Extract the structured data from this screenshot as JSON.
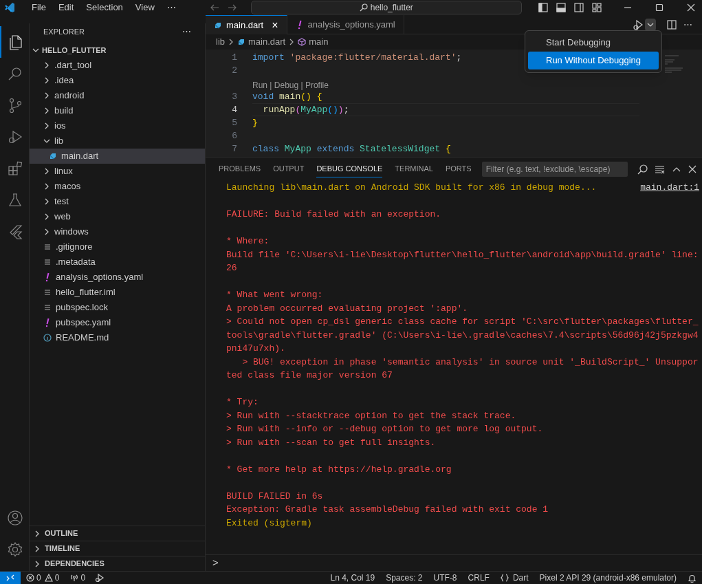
{
  "title_bar": {
    "menus": [
      "File",
      "Edit",
      "Selection",
      "View",
      "⋯"
    ],
    "search": "hello_flutter"
  },
  "activity_bar": {
    "top": [
      {
        "kind": "explorer",
        "selected": true
      },
      {
        "kind": "search",
        "selected": false
      },
      {
        "kind": "source-control",
        "selected": false
      },
      {
        "kind": "run-debug",
        "selected": false
      },
      {
        "kind": "extensions",
        "selected": false
      },
      {
        "kind": "testing",
        "selected": false
      },
      {
        "kind": "flutter",
        "selected": false
      }
    ],
    "bottom": [
      {
        "kind": "account"
      },
      {
        "kind": "settings"
      }
    ]
  },
  "sidebar": {
    "title": "EXPLORER",
    "more": "⋯",
    "root": "HELLO_FLUTTER",
    "items": [
      {
        "label": ".dart_tool",
        "kind": "folder",
        "expanded": false,
        "selected": false
      },
      {
        "label": ".idea",
        "kind": "folder",
        "expanded": false,
        "selected": false
      },
      {
        "label": "android",
        "kind": "folder",
        "expanded": false,
        "selected": false
      },
      {
        "label": "build",
        "kind": "folder",
        "expanded": false,
        "selected": false
      },
      {
        "label": "ios",
        "kind": "folder",
        "expanded": false,
        "selected": false
      },
      {
        "label": "lib",
        "kind": "folder",
        "expanded": true,
        "selected": false,
        "children": [
          {
            "label": "main.dart",
            "kind": "dart",
            "selected": true
          }
        ]
      },
      {
        "label": "linux",
        "kind": "folder",
        "expanded": false,
        "selected": false
      },
      {
        "label": "macos",
        "kind": "folder",
        "expanded": false,
        "selected": false
      },
      {
        "label": "test",
        "kind": "folder",
        "expanded": false,
        "selected": false
      },
      {
        "label": "web",
        "kind": "folder",
        "expanded": false,
        "selected": false
      },
      {
        "label": "windows",
        "kind": "folder",
        "expanded": false,
        "selected": false
      },
      {
        "label": ".gitignore",
        "kind": "text",
        "selected": false
      },
      {
        "label": ".metadata",
        "kind": "text",
        "selected": false
      },
      {
        "label": "analysis_options.yaml",
        "kind": "yaml",
        "selected": false
      },
      {
        "label": "hello_flutter.iml",
        "kind": "text",
        "selected": false
      },
      {
        "label": "pubspec.lock",
        "kind": "text",
        "selected": false
      },
      {
        "label": "pubspec.yaml",
        "kind": "yaml",
        "selected": false
      },
      {
        "label": "README.md",
        "kind": "info",
        "selected": false
      }
    ],
    "sections": [
      "OUTLINE",
      "TIMELINE",
      "DEPENDENCIES"
    ]
  },
  "editor": {
    "tabs": [
      {
        "label": "main.dart",
        "kind": "dart",
        "selected": true,
        "close": "×"
      },
      {
        "label": "analysis_options.yaml",
        "kind": "yaml",
        "selected": false
      }
    ],
    "breadcrumb": [
      "lib",
      "main.dart",
      "main"
    ],
    "lines": [
      {
        "number": "1",
        "current": false,
        "tokens": [
          {
            "t": "import ",
            "kind": "keyword"
          },
          {
            "t": "'package:flutter/material.dart'",
            "kind": "string"
          },
          {
            "t": ";",
            "kind": "plain"
          }
        ]
      },
      {
        "number": "2",
        "current": false
      },
      {
        "number": "3",
        "current": false,
        "lens": "Run | Debug | Profile",
        "tokens": [
          {
            "t": "void ",
            "kind": "keyword"
          },
          {
            "t": "main",
            "kind": "function"
          },
          {
            "t": "() {",
            "kind": "bracket"
          }
        ]
      },
      {
        "number": "4",
        "current": true,
        "tokens": [
          {
            "t": "  runApp",
            "kind": "function"
          },
          {
            "t": "(",
            "kind": "bracket2"
          },
          {
            "t": "MyApp",
            "kind": "class"
          },
          {
            "t": "()",
            "kind": "bracket3"
          },
          {
            "t": ")",
            "kind": "bracket2"
          },
          {
            "t": ";",
            "kind": "plain"
          }
        ]
      },
      {
        "number": "5",
        "current": false,
        "tokens": [
          {
            "t": "}",
            "kind": "bracket"
          }
        ]
      },
      {
        "number": "6",
        "current": false
      },
      {
        "number": "7",
        "current": false,
        "tokens": [
          {
            "t": "class ",
            "kind": "keyword"
          },
          {
            "t": "MyApp ",
            "kind": "class"
          },
          {
            "t": "extends ",
            "kind": "keyword"
          },
          {
            "t": "StatelessWidget ",
            "kind": "class"
          },
          {
            "t": "{",
            "kind": "bracket"
          }
        ]
      }
    ]
  },
  "run_menu": {
    "items": [
      {
        "label": "Start Debugging",
        "selected": false
      },
      {
        "label": "Run Without Debugging",
        "selected": true
      }
    ]
  },
  "panel": {
    "tabs": [
      {
        "label": "PROBLEMS",
        "selected": false
      },
      {
        "label": "OUTPUT",
        "selected": false
      },
      {
        "label": "DEBUG CONSOLE",
        "selected": true
      },
      {
        "label": "TERMINAL",
        "selected": false
      },
      {
        "label": "PORTS",
        "selected": false
      }
    ],
    "filter_placeholder": "Filter (e.g. text, !exclude, \\escape)",
    "source_link": "main.dart:1",
    "blocks": [
      [
        {
          "text": "Launching lib\\main.dart on Android SDK built for x86 in debug mode...",
          "kind": "info"
        }
      ],
      [
        {
          "text": "FAILURE: Build failed with an exception.",
          "kind": "error"
        }
      ],
      [
        {
          "text": "* Where:",
          "kind": "error"
        },
        {
          "text": "Build file 'C:\\Users\\i-lie\\Desktop\\flutter\\hello_flutter\\android\\app\\build.gradle' line: 26",
          "kind": "error"
        }
      ],
      [
        {
          "text": "* What went wrong:",
          "kind": "error"
        },
        {
          "text": "A problem occurred evaluating project ':app'.",
          "kind": "error"
        },
        {
          "text": "> Could not open cp_dsl generic class cache for script 'C:\\src\\flutter\\packages\\flutter_tools\\gradle\\flutter.gradle' (C:\\Users\\i-lie\\.gradle\\caches\\7.4\\scripts\\56d96j42j5pzkgw4pni47u7xh).",
          "kind": "error"
        },
        {
          "text": "   > BUG! exception in phase 'semantic analysis' in source unit '_BuildScript_' Unsupported class file major version 67",
          "kind": "error"
        }
      ],
      [
        {
          "text": "* Try:",
          "kind": "error"
        },
        {
          "text": "> Run with --stacktrace option to get the stack trace.",
          "kind": "error"
        },
        {
          "text": "> Run with --info or --debug option to get more log output.",
          "kind": "error"
        },
        {
          "text": "> Run with --scan to get full insights.",
          "kind": "error"
        }
      ],
      [
        {
          "text": "* Get more help at https://help.gradle.org",
          "kind": "error"
        }
      ],
      [
        {
          "text": "BUILD FAILED in 6s",
          "kind": "error"
        },
        {
          "text": "Exception: Gradle task assembleDebug failed with exit code 1",
          "kind": "error"
        },
        {
          "text": "Exited (sigterm)",
          "kind": "info"
        }
      ]
    ],
    "prompt": ">"
  },
  "status_bar": {
    "errors": "0",
    "warnings": "0",
    "ports": "0",
    "right": [
      {
        "text": "Ln 4, Col 19",
        "kind": "text"
      },
      {
        "text": "Spaces: 2",
        "kind": "text"
      },
      {
        "text": "UTF-8",
        "kind": "text"
      },
      {
        "text": "CRLF",
        "kind": "text"
      },
      {
        "text": "Dart",
        "kind": "language"
      },
      {
        "text": "Pixel 2 API 29 (android-x86 emulator)",
        "kind": "text"
      }
    ]
  }
}
